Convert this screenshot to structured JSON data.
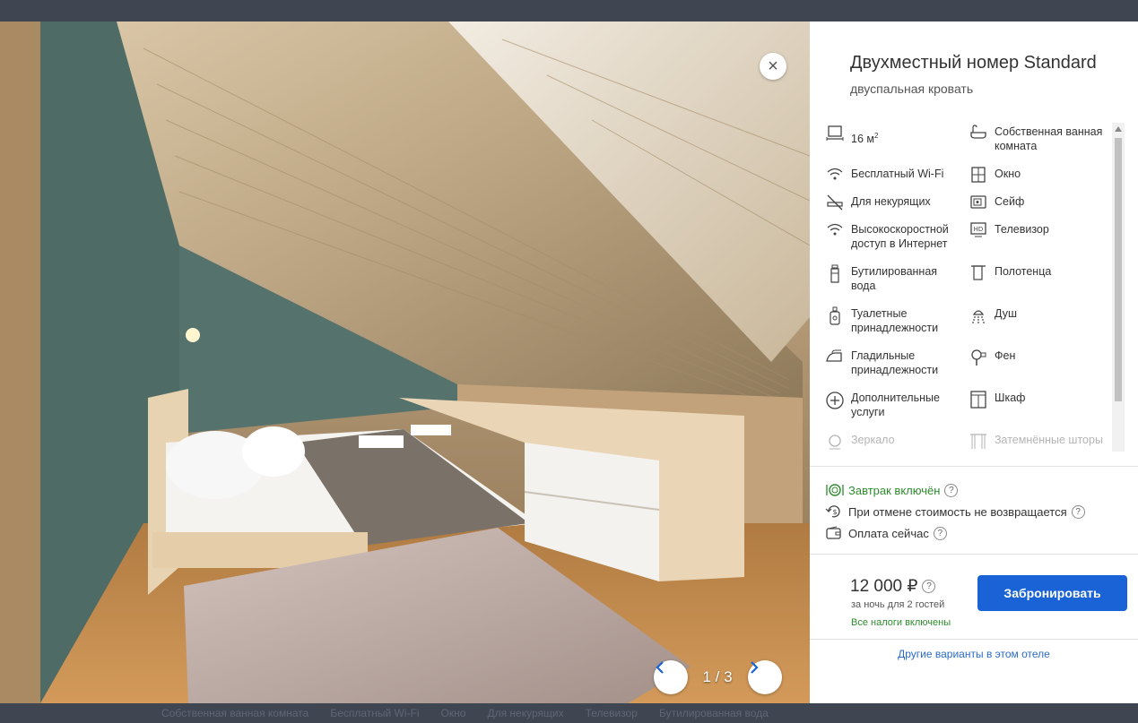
{
  "modal": {
    "room_title": "Двухместный номер Standard",
    "room_subtitle": "двуспальная кровать",
    "close_label": "×"
  },
  "gallery": {
    "counter": "1 / 3",
    "current": 1,
    "total": 3
  },
  "amenities": [
    {
      "label": "16 м",
      "sup": "2",
      "icon": "area-icon"
    },
    {
      "label": "Собственная ванная комната",
      "icon": "bathtub-icon"
    },
    {
      "label": "Бесплатный Wi-Fi",
      "icon": "wifi-icon"
    },
    {
      "label": "Окно",
      "icon": "window-icon"
    },
    {
      "label": "Для некурящих",
      "icon": "no-smoking-icon"
    },
    {
      "label": "Сейф",
      "icon": "safe-icon"
    },
    {
      "label": "Высокоскоростной доступ в Интернет",
      "icon": "wifi-icon"
    },
    {
      "label": "Телевизор",
      "icon": "tv-icon"
    },
    {
      "label": "Бутилированная вода",
      "icon": "water-bottle-icon"
    },
    {
      "label": "Полотенца",
      "icon": "towel-icon"
    },
    {
      "label": "Туалетные принадлежности",
      "icon": "toiletries-icon"
    },
    {
      "label": "Душ",
      "icon": "shower-icon"
    },
    {
      "label": "Гладильные принадлежности",
      "icon": "iron-icon"
    },
    {
      "label": "Фен",
      "icon": "hairdryer-icon"
    },
    {
      "label": "Дополнительные услуги",
      "icon": "plus-circle-icon"
    },
    {
      "label": "Шкаф",
      "icon": "wardrobe-icon"
    },
    {
      "label": "Зеркало",
      "icon": "mirror-icon"
    },
    {
      "label": "Затемнённые шторы",
      "icon": "curtains-icon"
    }
  ],
  "conditions": {
    "breakfast": "Завтрак включён",
    "cancellation": "При отмене стоимость не возвращается",
    "payment": "Оплата сейчас",
    "help_glyph": "?"
  },
  "pricing": {
    "price": "12 000 ₽",
    "per_night": "за ночь для 2 гостей",
    "taxes": "Все налоги включены",
    "book_label": "Забронировать",
    "other_options": "Другие варианты в этом отеле"
  },
  "background_page": {
    "amenity_strip": [
      "Собственная ванная комната",
      "Бесплатный Wi-Fi",
      "Окно",
      "Для некурящих",
      "Телевизор",
      "Бутилированная вода"
    ]
  },
  "colors": {
    "accent": "#1a63d6",
    "success": "#2e8b2e",
    "link": "#2b6bc8"
  }
}
